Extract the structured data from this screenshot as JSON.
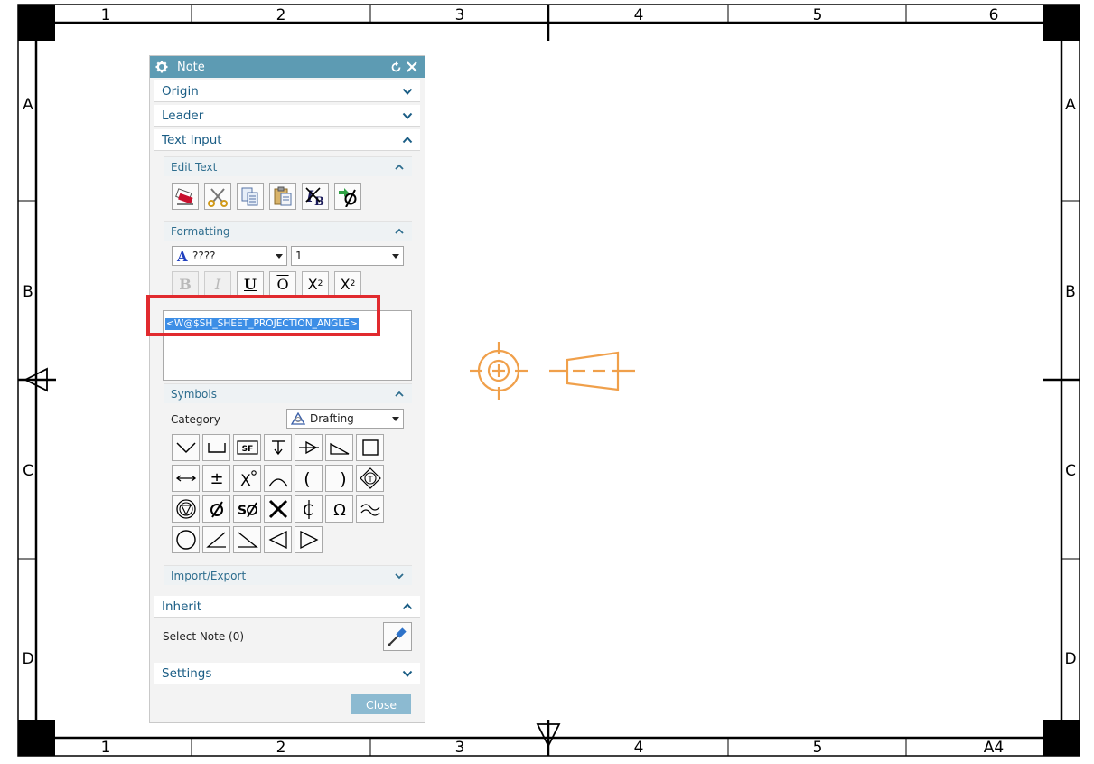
{
  "drawing": {
    "columns": [
      "1",
      "2",
      "3",
      "4",
      "5",
      "6"
    ],
    "bottom_columns": [
      "1",
      "2",
      "3",
      "4",
      "5",
      "A4"
    ],
    "rows": [
      "A",
      "B",
      "C",
      "D"
    ]
  },
  "dialog": {
    "title": "Note",
    "title_icons": [
      "gear-icon",
      "reset-icon",
      "close-icon"
    ],
    "sections": {
      "origin": "Origin",
      "leader": "Leader",
      "text_input": "Text Input",
      "inherit": "Inherit",
      "settings": "Settings"
    },
    "subsections": {
      "edit_text": "Edit Text",
      "formatting": "Formatting",
      "symbols": "Symbols",
      "import_export": "Import/Export"
    },
    "edit_text_tools": [
      "eraser-icon",
      "cut-icon",
      "copy-icon",
      "paste-icon",
      "delete-text-icon",
      "insert-symbol-icon"
    ],
    "formatting": {
      "font": "????",
      "size": "1",
      "bold": "B",
      "italic": "I",
      "underline": "U",
      "overline": "O",
      "superscript": "X",
      "subscript": "X",
      "sup_mark": "2",
      "sub_mark": "2"
    },
    "text_value": "<W@$SH_SHEET_PROJECTION_ANGLE>",
    "symbols": {
      "category_label": "Category",
      "category_value": "Drafting"
    },
    "inherit": {
      "select_note": "Select Note (0)"
    },
    "close_label": "Close"
  },
  "colors": {
    "title_bar": "#5d9bb3",
    "section_text": "#1a5d85",
    "symbol_orange": "#f0a04b",
    "highlight_red": "#e12a2e",
    "selection_blue": "#3d8ee6"
  }
}
